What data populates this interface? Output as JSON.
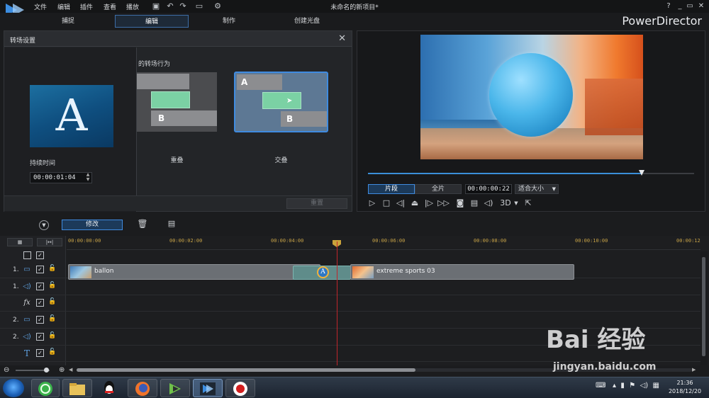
{
  "menu": {
    "file": "文件",
    "edit": "编辑",
    "plugins": "插件",
    "view": "查看",
    "playback": "播放"
  },
  "window": {
    "title": "未命名的新项目*",
    "help": "?",
    "minimize": "_",
    "restore": "▭",
    "close": "✕",
    "brand": "PowerDirector"
  },
  "mode_tabs": {
    "capture": "捕捉",
    "edit": "编辑",
    "produce": "制作",
    "disc": "创建光盘"
  },
  "transition_panel": {
    "title": "转场设置",
    "preview_letter": "A",
    "duration_label": "持续时间",
    "duration_value": "00:00:01:04",
    "behavior_label": "的转场行为",
    "option_overlap": "重叠",
    "option_crossfade": "交叠",
    "letter_a": "A",
    "letter_b": "B",
    "reset_label": "重置"
  },
  "preview": {
    "progress_fraction": 0.84,
    "btn_clip": "片段",
    "btn_full": "全片",
    "timecode": "00:00:00:22",
    "zoom_select": "适合大小",
    "mode_3d": "3D"
  },
  "toolbar": {
    "modify_label": "修改"
  },
  "timeline": {
    "ticks": [
      "00:00:00:00",
      "00:00:02:00",
      "00:00:04:00",
      "00:00:06:00",
      "00:00:08:00",
      "00:00:10:00",
      "00:00:12"
    ],
    "tracks": [
      {
        "num": "1.",
        "icon": "video-track-icon"
      },
      {
        "num": "1.",
        "icon": "audio-track-icon"
      },
      {
        "num": "",
        "icon": "fx-track-icon"
      },
      {
        "num": "2.",
        "icon": "video-track-icon"
      },
      {
        "num": "2.",
        "icon": "audio-track-icon"
      },
      {
        "num": "",
        "icon": "title-track-icon"
      }
    ],
    "clips": {
      "clip1": "ballon",
      "clip2": "extreme sports 03",
      "transition_letter": "A"
    },
    "fx_label": "fx",
    "title_label": "T"
  },
  "taskbar": {
    "time": "21:36",
    "date": "2018/12/20"
  },
  "watermark": {
    "logo": "Bai 经验",
    "url": "jingyan.baidu.com"
  },
  "colors": {
    "accent": "#3f8be0",
    "playhead": "#c0262b",
    "ruler": "#c6a247",
    "transition_green": "#7bd1a4"
  }
}
